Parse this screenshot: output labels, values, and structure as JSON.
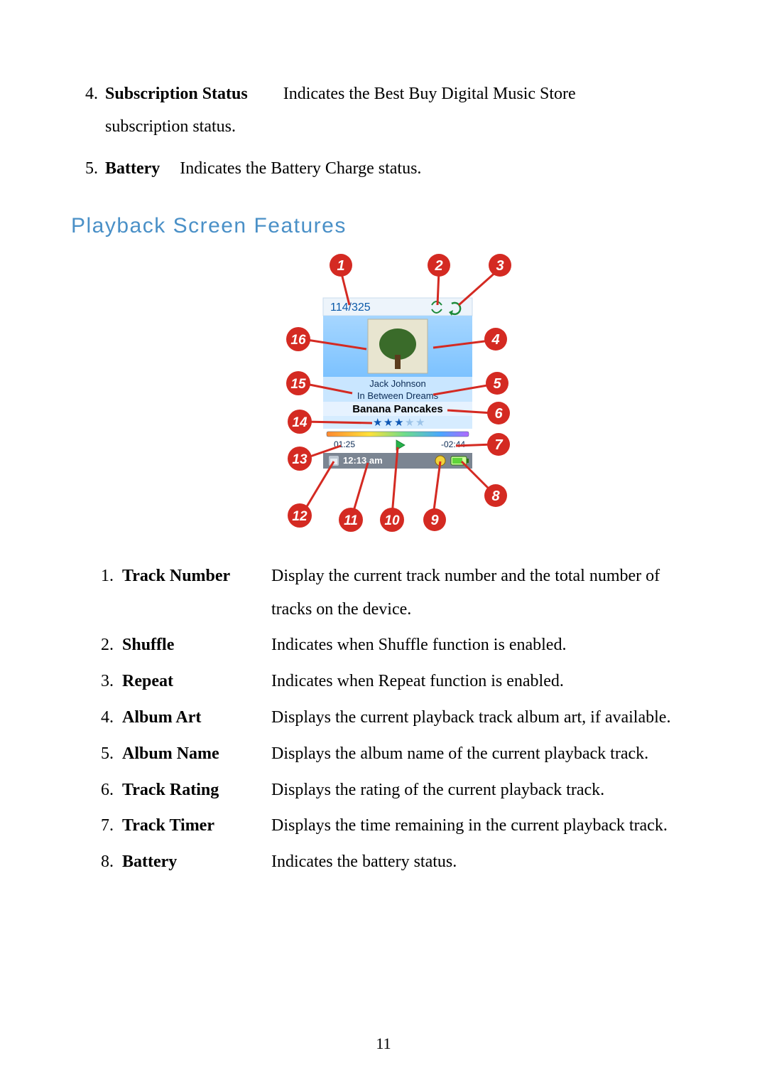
{
  "page_number": "11",
  "top_items": [
    {
      "num": "4.",
      "term": "Subscription Status",
      "desc_inline": "Indicates the Best Buy Digital Music Store",
      "desc_wrap": "subscription status."
    },
    {
      "num": "5.",
      "term": "Battery",
      "desc_inline": "Indicates the Battery Charge status.",
      "desc_wrap": ""
    }
  ],
  "section_heading": "Playback Screen Features",
  "diagram": {
    "callouts": {
      "1": "1",
      "2": "2",
      "3": "3",
      "4": "4",
      "5": "5",
      "6": "6",
      "7": "7",
      "8": "8",
      "9": "9",
      "10": "10",
      "11": "11",
      "12": "12",
      "13": "13",
      "14": "14",
      "15": "15",
      "16": "16"
    },
    "screen": {
      "track_counter": "114/325",
      "artist": "Jack Johnson",
      "album": "In Between Dreams",
      "track_title": "Banana Pancakes",
      "rating_filled": 3,
      "rating_total": 5,
      "elapsed": "01:25",
      "remaining": "-02:44",
      "clock": "12:13 am"
    }
  },
  "features": [
    {
      "num": "1.",
      "term": "Track Number",
      "desc": "Display the current track number and the total number of tracks on the device."
    },
    {
      "num": "2.",
      "term": "Shuffle",
      "desc": "Indicates when Shuffle function is enabled."
    },
    {
      "num": "3.",
      "term": "Repeat",
      "desc": "Indicates when Repeat function is enabled."
    },
    {
      "num": "4.",
      "term": "Album Art",
      "desc": "Displays the current playback track album art, if available."
    },
    {
      "num": "5.",
      "term": "Album Name",
      "desc": "Displays the album name of the current playback track."
    },
    {
      "num": "6.",
      "term": "Track Rating",
      "desc": "Displays the rating of the current playback track."
    },
    {
      "num": "7.",
      "term": "Track Timer",
      "desc": "Displays the time remaining in the current playback track."
    },
    {
      "num": "8.",
      "term": "Battery",
      "desc": "Indicates the battery status."
    }
  ]
}
